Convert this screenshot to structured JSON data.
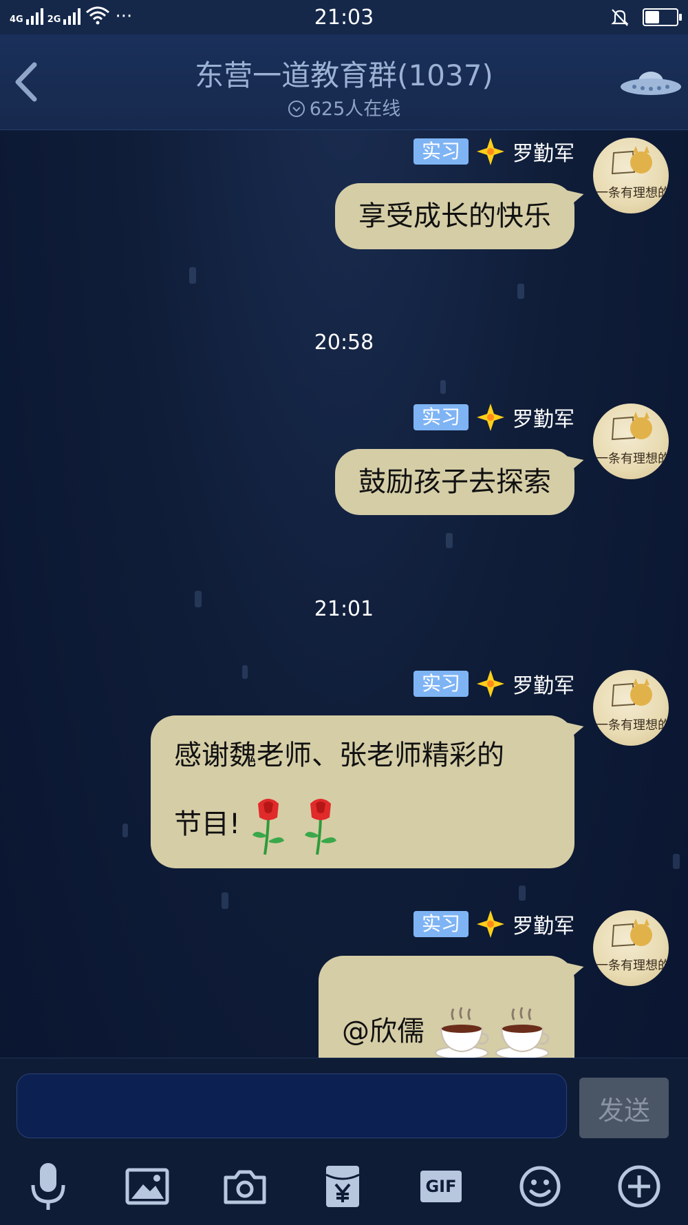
{
  "status_bar": {
    "network_1": "4G",
    "network_2": "2G",
    "more": "···",
    "time": "21:03"
  },
  "header": {
    "title": "东营一道教育群(1037)",
    "online": "625人在线"
  },
  "messages": [
    {
      "tag": "实习",
      "sender": "罗勤军",
      "text": "享受成长的快乐"
    },
    {
      "timestamp": "20:58"
    },
    {
      "tag": "实习",
      "sender": "罗勤军",
      "text": "鼓励孩子去探索"
    },
    {
      "timestamp": "21:01"
    },
    {
      "tag": "实习",
      "sender": "罗勤军",
      "line1": "感谢魏老师、张老师精彩的",
      "line2": "节目!",
      "emoji": [
        "rose",
        "rose"
      ]
    },
    {
      "tag": "实习",
      "sender": "罗勤军",
      "text": "@欣儒",
      "emoji": [
        "coffee",
        "coffee"
      ]
    }
  ],
  "input": {
    "placeholder": "",
    "send_label": "发送"
  },
  "toolbar": {
    "gif_label": "GIF",
    "icons": [
      "microphone-icon",
      "image-icon",
      "camera-icon",
      "red-packet-icon",
      "gif-icon",
      "emoji-icon",
      "plus-icon"
    ]
  },
  "colors": {
    "bubble": "#d5cda6",
    "tag": "#7fb4f4",
    "background": "#0d1a33"
  }
}
